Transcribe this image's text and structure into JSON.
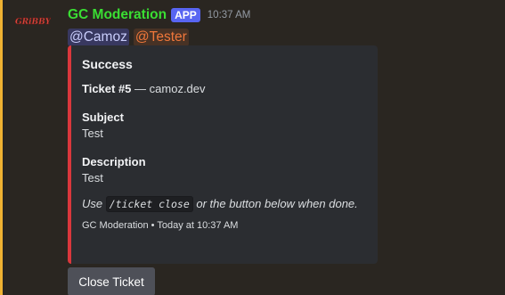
{
  "message": {
    "author": "GC Moderation",
    "badge": "APP",
    "timestamp": "10:37 AM",
    "mentions": [
      "@Camoz",
      "@Tester"
    ]
  },
  "embed": {
    "title": "Success",
    "ticket_label": "Ticket #5",
    "ticket_separator": " — ",
    "ticket_host": "camoz.dev",
    "fields": [
      {
        "name": "Subject",
        "value": "Test"
      },
      {
        "name": "Description",
        "value": "Test"
      }
    ],
    "usage_prefix": "Use ",
    "usage_command": "/ticket close",
    "usage_suffix": " or the button below when done.",
    "footer": "GC Moderation • Today at 10:37 AM"
  },
  "buttons": {
    "close_ticket": "Close Ticket"
  },
  "colors": {
    "author": "#3ade33",
    "app_badge": "#5865f2",
    "embed_accent": "#da373c",
    "mention_highlight_bar": "#f0b232"
  },
  "avatar": {
    "text": "GRiBBY"
  }
}
